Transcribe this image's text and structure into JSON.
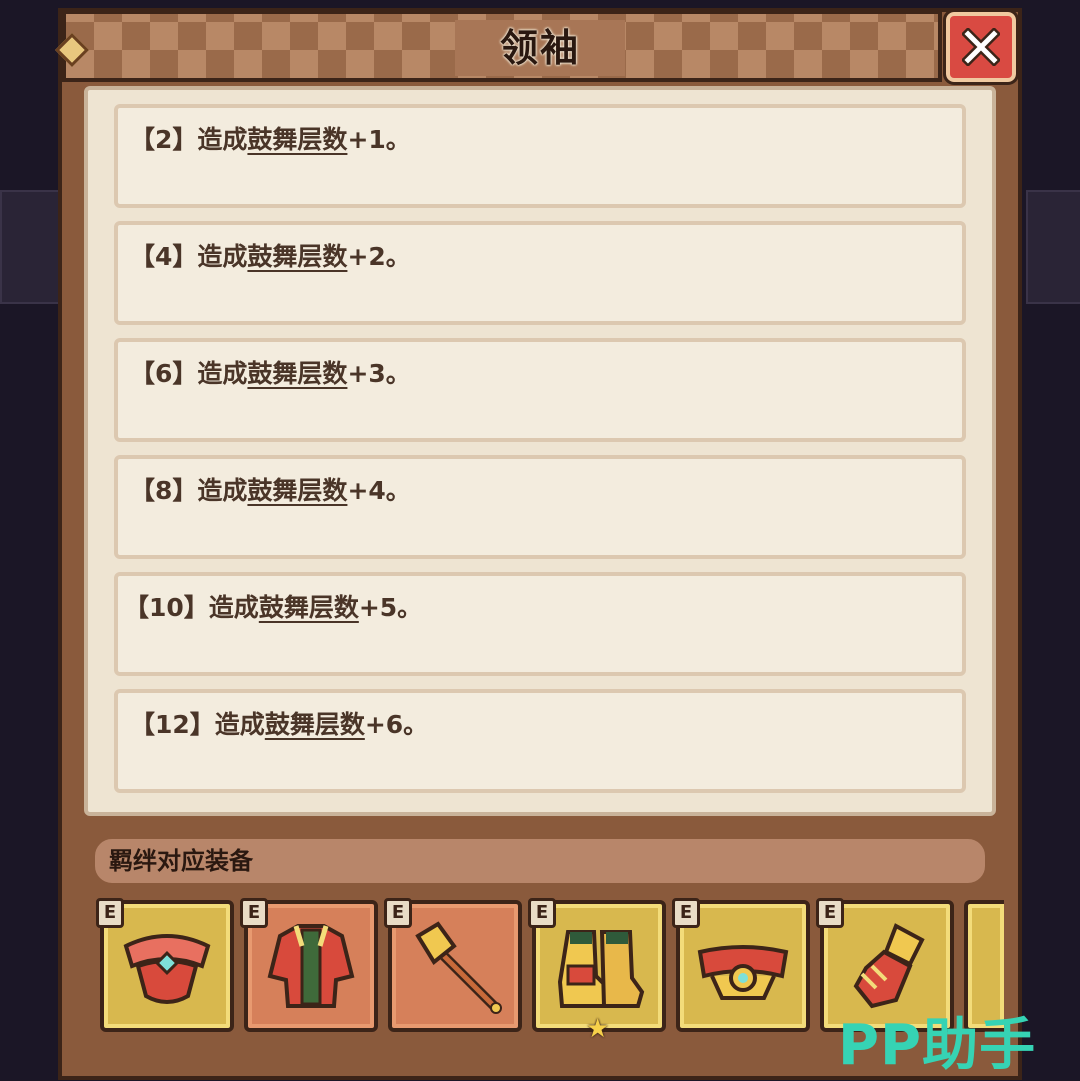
{
  "dialog": {
    "title": "领袖"
  },
  "bonuses": [
    {
      "tier": "【2】",
      "prefix": "造成",
      "keyword": "鼓舞层数",
      "suffix": "+1。"
    },
    {
      "tier": "【4】",
      "prefix": "造成",
      "keyword": "鼓舞层数",
      "suffix": "+2。"
    },
    {
      "tier": "【6】",
      "prefix": "造成",
      "keyword": "鼓舞层数",
      "suffix": "+3。"
    },
    {
      "tier": "【8】",
      "prefix": "造成",
      "keyword": "鼓舞层数",
      "suffix": "+4。"
    },
    {
      "tier": "【10】",
      "prefix": "造成",
      "keyword": "鼓舞层数",
      "suffix": "+5。"
    },
    {
      "tier": "【12】",
      "prefix": "造成",
      "keyword": "鼓舞层数",
      "suffix": "+6。"
    }
  ],
  "equipment": {
    "label": "羁绊对应装备",
    "badge": "E",
    "items": [
      {
        "icon": "necklace-icon",
        "frame": "gold"
      },
      {
        "icon": "armor-icon",
        "frame": "orange"
      },
      {
        "icon": "wand-icon",
        "frame": "orange"
      },
      {
        "icon": "boots-icon",
        "frame": "gold",
        "starred": true
      },
      {
        "icon": "belt-icon",
        "frame": "gold"
      },
      {
        "icon": "gloves-icon",
        "frame": "gold"
      }
    ]
  },
  "watermark": "PP助手",
  "colors": {
    "close": "#d94a42",
    "panel": "#8a5a3c",
    "card": "#f3ecde",
    "gold_frame": "#d8b84e",
    "orange_frame": "#d6805a",
    "watermark": "#36d3b4"
  }
}
